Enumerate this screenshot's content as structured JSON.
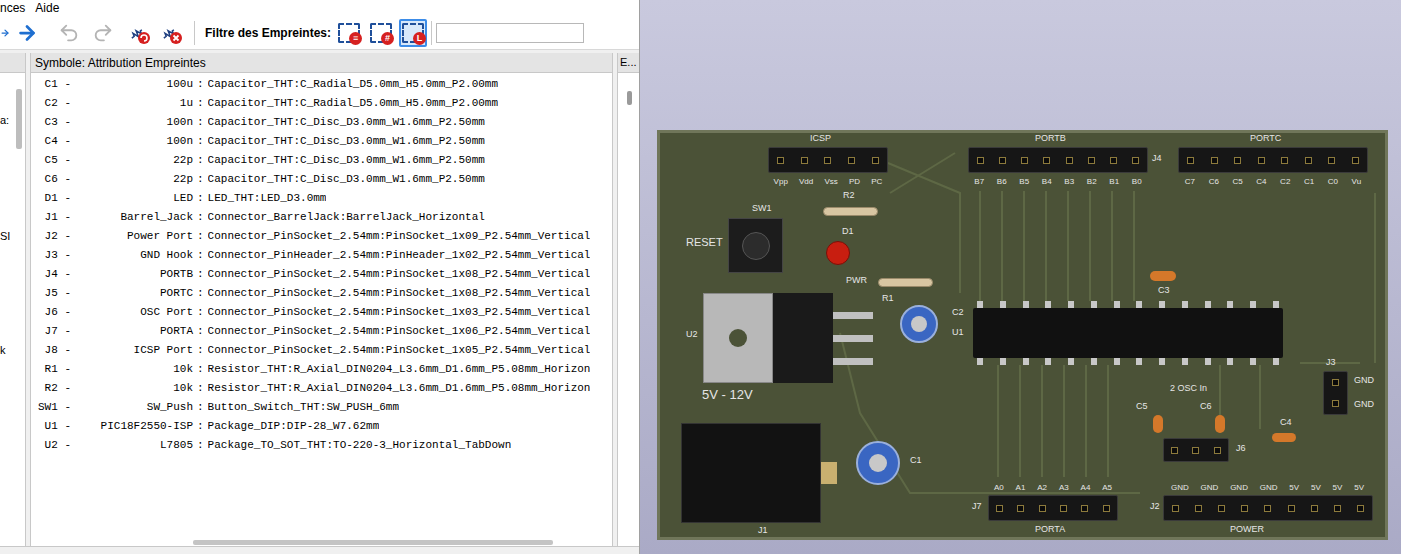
{
  "window": {
    "menu": [
      {
        "label": "nces"
      },
      {
        "label": "Aide"
      }
    ]
  },
  "toolbar": {
    "buttons": [
      {
        "kind": "back",
        "disabled": false
      },
      {
        "kind": "forward",
        "disabled": false
      },
      {
        "kind": "undo",
        "disabled": true
      },
      {
        "kind": "redo",
        "disabled": true
      },
      {
        "kind": "auto",
        "disabled": false
      },
      {
        "kind": "delete",
        "disabled": false
      }
    ]
  },
  "filter": {
    "label": "Filtre des Empreintes:",
    "buttons": [
      {
        "kind": "keywords",
        "badge": "≡",
        "selected": false
      },
      {
        "kind": "pins",
        "badge": "#",
        "selected": false
      },
      {
        "kind": "library",
        "badge": "L",
        "selected": true
      }
    ],
    "value": ""
  },
  "left_panel": {
    "fragments": [
      "a:",
      "SI",
      "k"
    ]
  },
  "assignments": {
    "header": "Symbole: Attribution Empreintes",
    "separator": ":",
    "rows": [
      {
        "ref": "C1 -",
        "value": "100u",
        "footprint": "Capacitor_THT:C_Radial_D5.0mm_H5.0mm_P2.00mm"
      },
      {
        "ref": "C2 -",
        "value": "1u",
        "footprint": "Capacitor_THT:C_Radial_D5.0mm_H5.0mm_P2.00mm"
      },
      {
        "ref": "C3 -",
        "value": "100n",
        "footprint": "Capacitor_THT:C_Disc_D3.0mm_W1.6mm_P2.50mm"
      },
      {
        "ref": "C4 -",
        "value": "100n",
        "footprint": "Capacitor_THT:C_Disc_D3.0mm_W1.6mm_P2.50mm"
      },
      {
        "ref": "C5 -",
        "value": "22p",
        "footprint": "Capacitor_THT:C_Disc_D3.0mm_W1.6mm_P2.50mm"
      },
      {
        "ref": "C6 -",
        "value": "22p",
        "footprint": "Capacitor_THT:C_Disc_D3.0mm_W1.6mm_P2.50mm"
      },
      {
        "ref": "D1 -",
        "value": "LED",
        "footprint": "LED_THT:LED_D3.0mm"
      },
      {
        "ref": "J1 -",
        "value": "Barrel_Jack",
        "footprint": "Connector_BarrelJack:BarrelJack_Horizontal"
      },
      {
        "ref": "J2 -",
        "value": "Power Port",
        "footprint": "Connector_PinSocket_2.54mm:PinSocket_1x09_P2.54mm_Vertical"
      },
      {
        "ref": "J3 -",
        "value": "GND Hook",
        "footprint": "Connector_PinHeader_2.54mm:PinHeader_1x02_P2.54mm_Vertical"
      },
      {
        "ref": "J4 -",
        "value": "PORTB",
        "footprint": "Connector_PinSocket_2.54mm:PinSocket_1x08_P2.54mm_Vertical"
      },
      {
        "ref": "J5 -",
        "value": "PORTC",
        "footprint": "Connector_PinSocket_2.54mm:PinSocket_1x08_P2.54mm_Vertical"
      },
      {
        "ref": "J6 -",
        "value": "OSC Port",
        "footprint": "Connector_PinSocket_2.54mm:PinSocket_1x03_P2.54mm_Vertical"
      },
      {
        "ref": "J7 -",
        "value": "PORTA",
        "footprint": "Connector_PinSocket_2.54mm:PinSocket_1x06_P2.54mm_Vertical"
      },
      {
        "ref": "J8 -",
        "value": "ICSP Port",
        "footprint": "Connector_PinSocket_2.54mm:PinSocket_1x05_P2.54mm_Vertical"
      },
      {
        "ref": "R1 -",
        "value": "10k",
        "footprint": "Resistor_THT:R_Axial_DIN0204_L3.6mm_D1.6mm_P5.08mm_Horizon"
      },
      {
        "ref": "R2 -",
        "value": "10k",
        "footprint": "Resistor_THT:R_Axial_DIN0204_L3.6mm_D1.6mm_P5.08mm_Horizon"
      },
      {
        "ref": "SW1 -",
        "value": "SW_Push",
        "footprint": "Button_Switch_THT:SW_PUSH_6mm"
      },
      {
        "ref": "U1 -",
        "value": "PIC18F2550-ISP",
        "footprint": "Package_DIP:DIP-28_W7.62mm"
      },
      {
        "ref": "U2 -",
        "value": "L7805",
        "footprint": "Package_TO_SOT_THT:TO-220-3_Horizontal_TabDown"
      }
    ]
  },
  "right_panel": {
    "header": "E..."
  },
  "board": {
    "labels": [
      "ICSP",
      "PORTB",
      "PORTC",
      "J4",
      "SW1",
      "RESET",
      "R2",
      "D1",
      "PWR",
      "R1",
      "C2",
      "U1",
      "U2",
      "5V - 12V",
      "C3",
      "J3",
      "GND",
      "GND",
      "2 OSC In",
      "C5",
      "C6",
      "J6",
      "C4",
      "J1",
      "C1",
      "J7",
      "PORTA",
      "J2",
      "POWER"
    ],
    "pin_labels": [
      [
        "Vpp",
        "Vdd",
        "Vss",
        "PD",
        "PC"
      ],
      [
        "B7",
        "B6",
        "B5",
        "B4",
        "B3",
        "B2",
        "B1",
        "B0"
      ],
      [
        "C7",
        "C6",
        "C5",
        "C4",
        "C2",
        "C1",
        "C0",
        "Vu"
      ],
      [
        "A0",
        "A1",
        "A2",
        "A3",
        "A4",
        "A5"
      ],
      [
        "GND",
        "GND",
        "GND",
        "GND",
        "5V",
        "5V",
        "5V",
        "5V"
      ]
    ]
  }
}
